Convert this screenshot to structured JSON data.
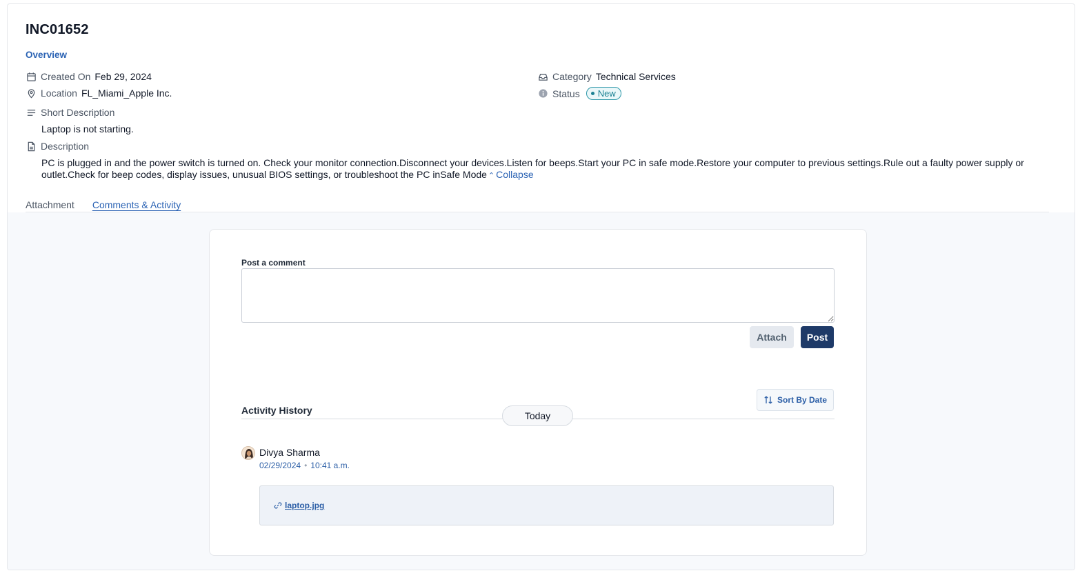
{
  "ticket": {
    "id": "INC01652"
  },
  "nav": {
    "overview": "Overview"
  },
  "meta": {
    "created_on_label": "Created On",
    "created_on_value": "Feb 29, 2024",
    "location_label": "Location",
    "location_value": "FL_Miami_Apple Inc.",
    "category_label": "Category",
    "category_value": "Technical Services",
    "status_label": "Status",
    "status_value": "New",
    "short_description_label": "Short Description",
    "short_description_value": "Laptop is not starting.",
    "description_label": "Description",
    "description_value": "PC is plugged in and the power switch is turned on. Check your monitor connection.Disconnect your devices.Listen for beeps.Start your PC in safe mode.Restore your computer to previous settings.Rule out a faulty power supply or outlet.Check for beep codes, display issues, unusual BIOS settings, or troubleshoot the PC inSafe Mode",
    "collapse_label": "Collapse"
  },
  "tabs": [
    {
      "label": "Attachment",
      "active": false
    },
    {
      "label": "Comments & Activity",
      "active": true
    }
  ],
  "comment": {
    "label": "Post a comment",
    "value": "",
    "attach_label": "Attach",
    "post_label": "Post"
  },
  "activity": {
    "title": "Activity History",
    "sort_label": "Sort By Date",
    "today_label": "Today",
    "entries": [
      {
        "user": "Divya Sharma",
        "date": "02/29/2024",
        "time": "10:41 a.m.",
        "attachment": "laptop.jpg"
      }
    ]
  },
  "icons": {
    "created_on": "calendar-icon",
    "location": "map-pin-icon",
    "short_description": "lines-icon",
    "description": "document-icon",
    "category": "inbox-icon",
    "status": "info-icon",
    "sort": "sort-arrows-icon",
    "attachment": "link-icon"
  },
  "colors": {
    "accent": "#2b63b4",
    "primary_button": "#1e3a68",
    "status_new": "#2c97a8"
  }
}
